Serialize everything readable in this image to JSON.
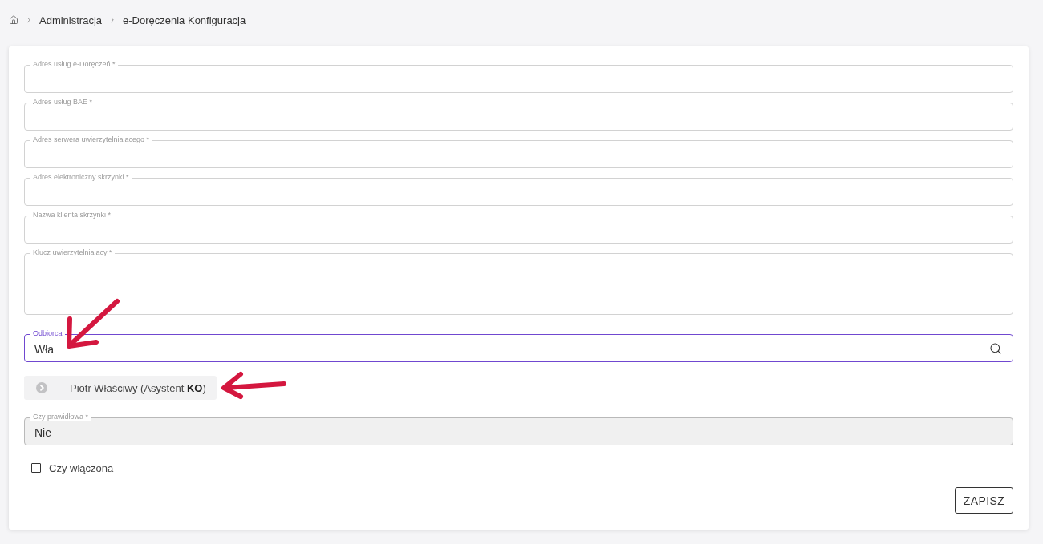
{
  "breadcrumb": {
    "items": [
      {
        "label": "Administracja"
      },
      {
        "label": "e-Doręczenia Konfiguracja"
      }
    ]
  },
  "form": {
    "fields": [
      {
        "kind": "text",
        "label": "Adres usług e-Doręczeń *",
        "focused": false
      },
      {
        "kind": "text",
        "label": "Adres usług BAE *",
        "focused": false
      },
      {
        "kind": "text",
        "label": "Adres serwera uwierzytelniającego *",
        "focused": false
      },
      {
        "kind": "text",
        "label": "Adres elektroniczny skrzynki *",
        "focused": false
      },
      {
        "kind": "text",
        "label": "Nazwa klienta skrzynki *",
        "focused": false
      },
      {
        "kind": "textarea",
        "label": "Klucz uwierzytelniający *",
        "focused": false
      },
      {
        "kind": "search",
        "label": "Odbiorca",
        "value": "Wła",
        "focused": true
      }
    ],
    "suggestions": [
      {
        "label": "Piotr Właściwy (Asystent **KO**)"
      }
    ],
    "validity_field": {
      "label": "Czy prawidłowa *",
      "value": "Nie",
      "disabled": true
    },
    "enabled_checkbox": {
      "label": "Czy włączona",
      "checked": false
    },
    "save_button": {
      "label": "ZAPISZ"
    }
  }
}
